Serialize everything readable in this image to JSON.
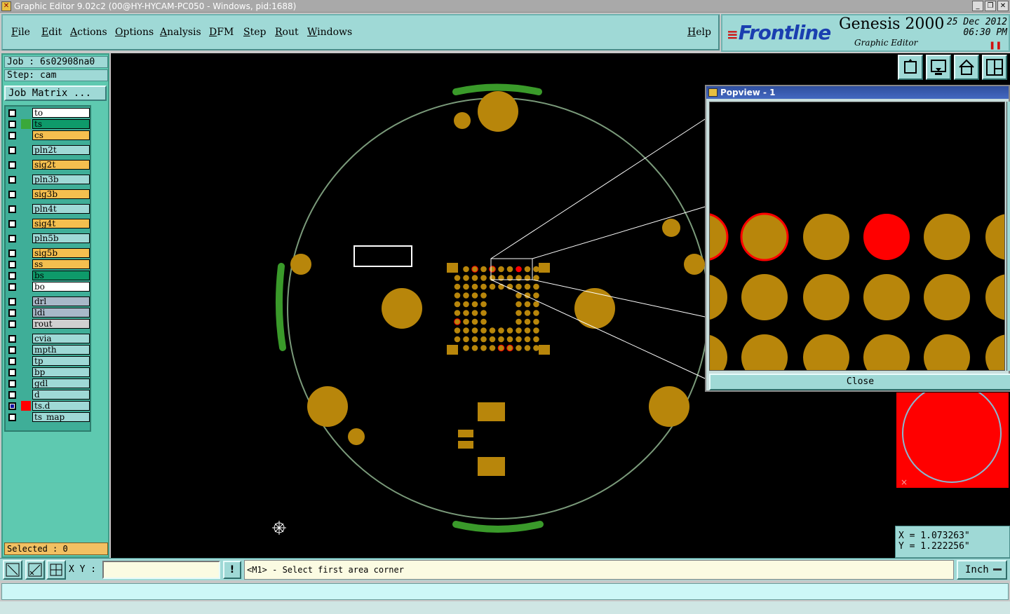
{
  "window": {
    "title": "Graphic Editor 9.02c2 (00@HY-HYCAM-PC050 - Windows, pid:1688)"
  },
  "menu": [
    "File",
    "Edit",
    "Actions",
    "Options",
    "Analysis",
    "DFM",
    "Step",
    "Rout",
    "Windows"
  ],
  "help_label": "Help",
  "brand": {
    "logo": "Frontline",
    "product": "Genesis 2000",
    "subproduct": "Graphic Editor",
    "date": "25 Dec 2012",
    "time": "06:30 PM"
  },
  "job": {
    "job_line": "Job : 6s02908na0",
    "step_line": "Step: cam",
    "matrix_button": "Job Matrix ..."
  },
  "layers": [
    {
      "name": "to",
      "color": "#ffffff",
      "swatch": "",
      "checked": false
    },
    {
      "name": "ts",
      "color": "#0e9a6a",
      "swatch": "#3aa83a",
      "checked": false
    },
    {
      "name": "cs",
      "color": "#f4bf4f",
      "swatch": "",
      "checked": false
    },
    {
      "name": "pln2t",
      "color": "#9fd9d6",
      "swatch": "",
      "checked": false
    },
    {
      "name": "sig2t",
      "color": "#f4bf4f",
      "swatch": "",
      "checked": false
    },
    {
      "name": "pln3b",
      "color": "#9fd9d6",
      "swatch": "",
      "checked": false
    },
    {
      "name": "sig3b",
      "color": "#f4bf4f",
      "swatch": "",
      "checked": false
    },
    {
      "name": "pln4t",
      "color": "#9fd9d6",
      "swatch": "",
      "checked": false
    },
    {
      "name": "sig4t",
      "color": "#f4bf4f",
      "swatch": "",
      "checked": false
    },
    {
      "name": "pln5b",
      "color": "#9fd9d6",
      "swatch": "",
      "checked": false
    },
    {
      "name": "sig5b",
      "color": "#f4bf4f",
      "swatch": "",
      "checked": false
    },
    {
      "name": "ss",
      "color": "#f4bf4f",
      "swatch": "",
      "checked": false
    },
    {
      "name": "bs",
      "color": "#0e9a6a",
      "swatch": "",
      "checked": false
    },
    {
      "name": "bo",
      "color": "#ffffff",
      "swatch": "",
      "checked": false
    },
    {
      "name": "drl",
      "color": "#a8b8c8",
      "swatch": "",
      "checked": false
    },
    {
      "name": "ldi",
      "color": "#a8b8c8",
      "swatch": "",
      "checked": false
    },
    {
      "name": "rout",
      "color": "#d0d0d0",
      "swatch": "",
      "checked": false
    },
    {
      "name": "cvia",
      "color": "#9fd9d6",
      "swatch": "",
      "checked": false
    },
    {
      "name": "mpth",
      "color": "#9fd9d6",
      "swatch": "",
      "checked": false
    },
    {
      "name": "tp",
      "color": "#9fd9d6",
      "swatch": "",
      "checked": false
    },
    {
      "name": "bp",
      "color": "#9fd9d6",
      "swatch": "",
      "checked": false
    },
    {
      "name": "gdl",
      "color": "#9fd9d6",
      "swatch": "",
      "checked": false
    },
    {
      "name": "d",
      "color": "#9fd9d6",
      "swatch": "",
      "checked": false
    },
    {
      "name": "ts.d",
      "color": "#9fd9d6",
      "swatch": "#ff0000",
      "checked": true
    },
    {
      "name": "ts_map",
      "color": "#9fd9d6",
      "swatch": "",
      "checked": false
    }
  ],
  "selected_label": "Selected : 0",
  "popview": {
    "title": "Popview - 1",
    "close_label": "Close"
  },
  "coords": {
    "x_line": "X = 1.073263\"",
    "y_line": "Y = 1.222256\""
  },
  "bottombar": {
    "xy_label": "X Y :",
    "xy_value": "",
    "excl_label": "!",
    "prompt": "<M1> - Select first area corner",
    "units": "Inch"
  },
  "colors": {
    "pad": "#b8860b",
    "outline": "#8a9a6a",
    "highlight": "#ff0000",
    "panel": "#9fd9d6"
  }
}
